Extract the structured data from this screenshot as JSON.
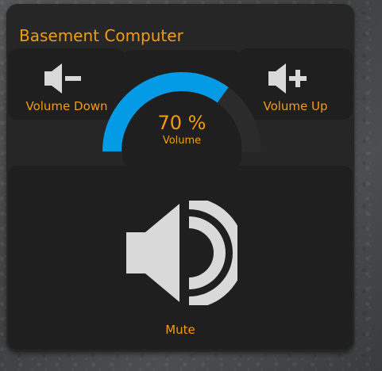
{
  "card": {
    "title": "Basement Computer"
  },
  "volume_down": {
    "label": "Volume Down",
    "icon": "volume-down-icon"
  },
  "volume_up": {
    "label": "Volume Up",
    "icon": "volume-up-icon"
  },
  "gauge": {
    "value": 70,
    "value_text": "70 %",
    "label": "Volume",
    "min": 0,
    "max": 100
  },
  "mute": {
    "label": "Mute",
    "icon": "speaker-icon"
  },
  "colors": {
    "accent": "#f39c12",
    "gauge_fill": "#039be5",
    "gauge_track": "#2b2b2b",
    "icon": "#d9d9d9",
    "card_bg": "#262626",
    "tile_bg": "#1f1f1f"
  }
}
